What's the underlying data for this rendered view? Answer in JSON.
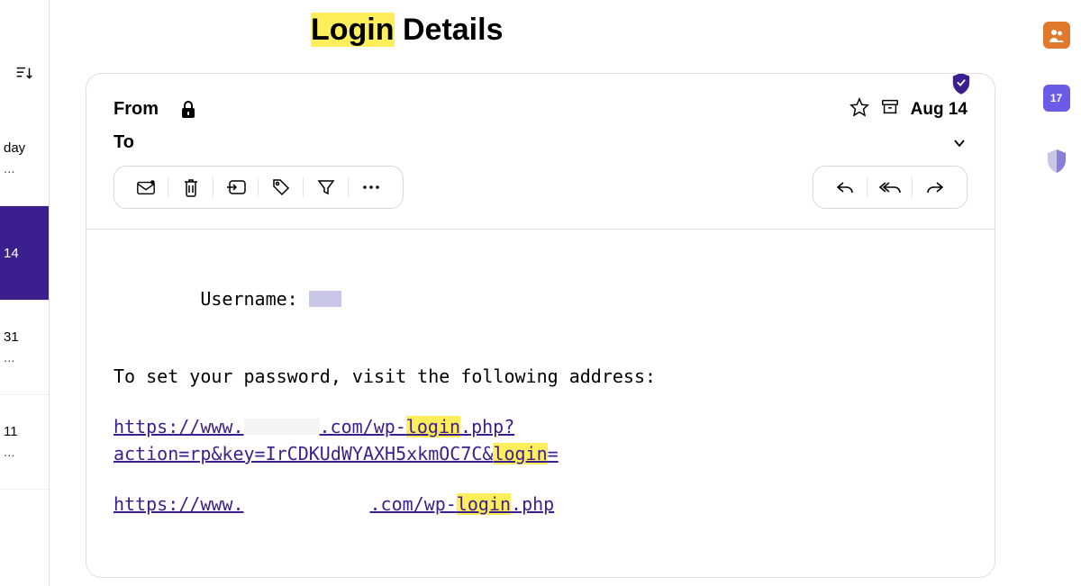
{
  "title": {
    "highlight": "Login",
    "rest": " Details"
  },
  "header": {
    "from_label": "From",
    "to_label": "To",
    "date": "Aug 14"
  },
  "sidebar": {
    "items": [
      {
        "label": "day",
        "dots": "..."
      },
      {
        "label": "14",
        "dots": ""
      },
      {
        "label": "31",
        "dots": "..."
      },
      {
        "label": "11",
        "dots": "..."
      }
    ]
  },
  "body": {
    "username_label": "Username: ",
    "instruction": "To set your password, visit the following address:",
    "link1": {
      "pre": "https://www.",
      "mid": ".com/wp-",
      "hl1": "login",
      "after1": ".php?",
      "line2a": "action=rp&key=IrCDKUdWYAXH5xkmOC7C&",
      "hl2": "login",
      "after2": "="
    },
    "link2": {
      "pre": "https://www.",
      "mid": ".com/wp-",
      "hl": "login",
      "after": ".php"
    }
  },
  "rail": {
    "calendar_number": "17"
  }
}
